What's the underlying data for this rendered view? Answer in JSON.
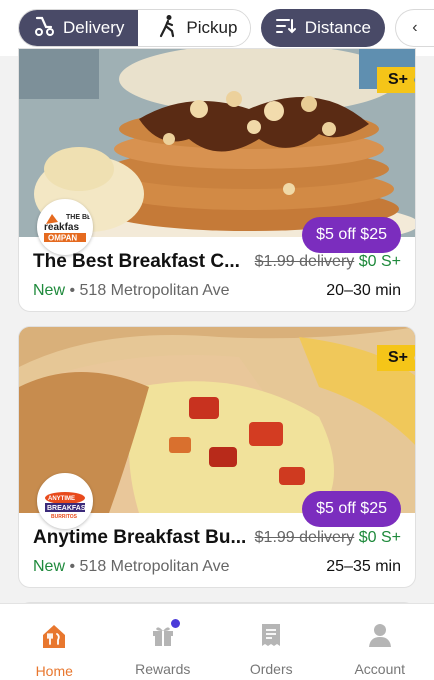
{
  "filters": {
    "delivery_label": "Delivery",
    "pickup_label": "Pickup",
    "sort_label": "Distance"
  },
  "stores": [
    {
      "name": "The Best Breakfast C...",
      "badge": "S+",
      "logo_text": "THE BEST BREAKFAST COMPANY",
      "promo": "$5 off $25",
      "old_fee": "$1.99 delivery",
      "new_fee": "$0 S+",
      "tag": "New",
      "separator": "•",
      "address": "518 Metropolitan Ave",
      "eta": "20–30 min"
    },
    {
      "name": "Anytime Breakfast Bu...",
      "badge": "S+",
      "logo_text": "ANYTIME BREAKFAST BURRITOS",
      "promo": "$5 off $25",
      "old_fee": "$1.99 delivery",
      "new_fee": "$0 S+",
      "tag": "New",
      "separator": "•",
      "address": "518 Metropolitan Ave",
      "eta": "25–35 min"
    }
  ],
  "nav": [
    {
      "label": "Home",
      "icon": "home-fork-knife-icon",
      "active": true
    },
    {
      "label": "Rewards",
      "icon": "gift-icon",
      "active": false,
      "has_badge": true
    },
    {
      "label": "Orders",
      "icon": "receipt-icon",
      "active": false
    },
    {
      "label": "Account",
      "icon": "person-icon",
      "active": false
    }
  ],
  "colors": {
    "chip_dark": "#494a67",
    "promo": "#7b2dbe",
    "splus": "#f5c518",
    "green": "#1f8a3c",
    "active_nav": "#e8772e",
    "badge_dot": "#4b3bd9"
  }
}
